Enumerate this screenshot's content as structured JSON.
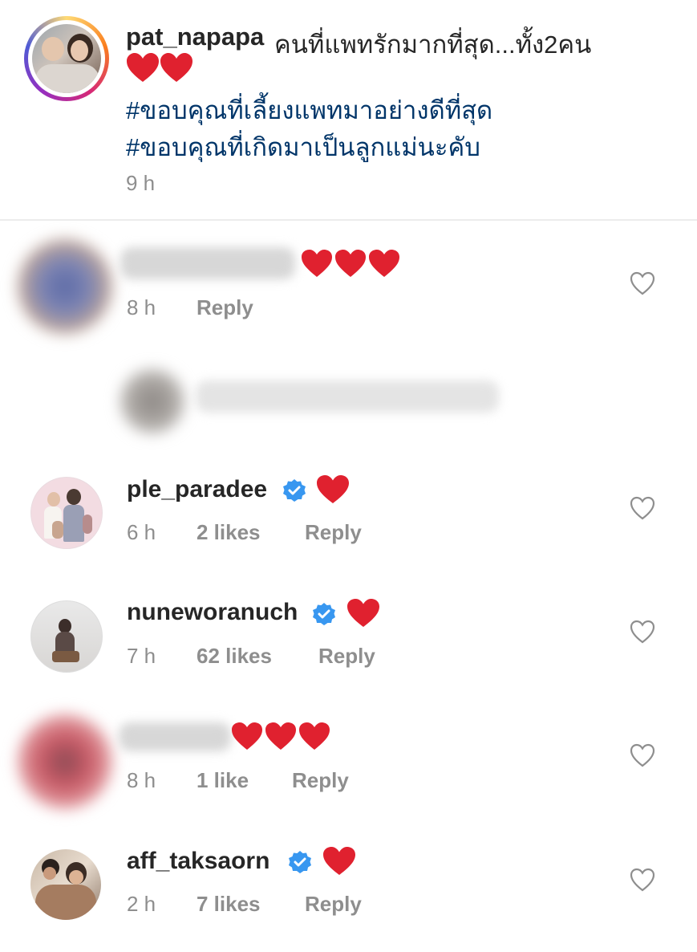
{
  "post": {
    "username": "pat_napapa",
    "caption": "คนที่แพทรักมากที่สุด...ทั้ง2คน",
    "caption_emoji": "❤️❤️",
    "hashtags": [
      "#ขอบคุณที่เลี้ยงแพทมาอย่างดีที่สุด",
      "#ขอบคุณที่เกิดมาเป็นลูกแม่นะคับ"
    ],
    "time": "9 h"
  },
  "comments": [
    {
      "username": "",
      "text": "❤️❤️❤️",
      "time": "8 h",
      "likes": "",
      "reply": "Reply",
      "blurred": true
    },
    {
      "username": "ple_paradee",
      "text": "❤️",
      "time": "6 h",
      "likes": "2 likes",
      "reply": "Reply",
      "verified": true
    },
    {
      "username": "nuneworanuch",
      "text": "❤️",
      "time": "7 h",
      "likes": "62 likes",
      "reply": "Reply",
      "verified": true
    },
    {
      "username": "",
      "text": "❤️❤️❤️",
      "time": "8 h",
      "likes": "1 like",
      "reply": "Reply",
      "blurred": true
    },
    {
      "username": "aff_taksaorn",
      "text": "❤️",
      "time": "2 h",
      "likes": "7 likes",
      "reply": "Reply",
      "verified": true
    }
  ],
  "colors": {
    "heart": "#e0212f",
    "verified": "#3897f0",
    "hashtag": "#003569",
    "meta": "#8e8e8e"
  },
  "icons": {
    "like": "heart-outline-icon",
    "verified": "verified-badge-icon",
    "emoji": "red-heart-emoji"
  }
}
